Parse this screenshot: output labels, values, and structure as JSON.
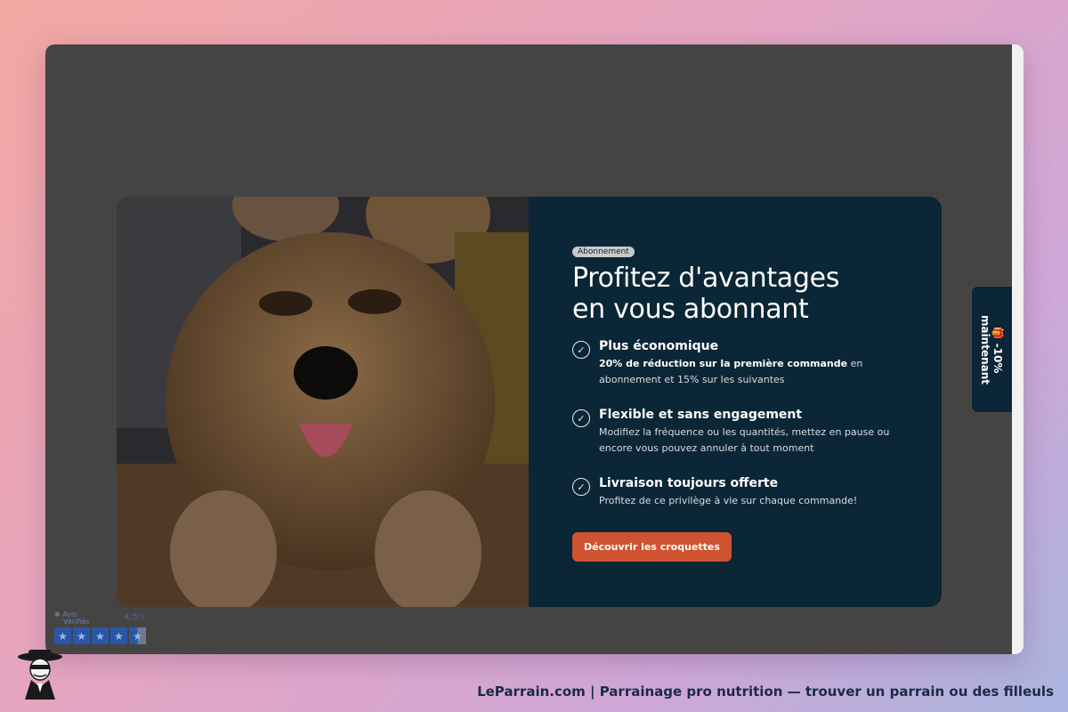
{
  "modal": {
    "badge": "Abonnement",
    "title_line1": "Profitez d'avantages",
    "title_line2": "en vous abonnant",
    "features": [
      {
        "title": "Plus économique",
        "desc_bold": "20% de réduction sur la première commande",
        "desc": " en abonnement et 15% sur les suivantes"
      },
      {
        "title": "Flexible et sans engagement",
        "desc": "Modifiez la fréquence ou les quantités, mettez en pause ou encore vous pouvez annuler à tout moment"
      },
      {
        "title": "Livraison toujours offerte",
        "desc": "Profitez de ce privilège à vie sur chaque commande!"
      }
    ],
    "cta_label": "Découvrir les croquettes",
    "image_alt": "dog-with-family-photo"
  },
  "side_tab": {
    "icon": "gift-icon",
    "line1": "-10%",
    "line2": "maintenant"
  },
  "reviews": {
    "brand_line1": "Avis",
    "brand_line2": "Vérifiés",
    "score": "4.5",
    "score_suffix": "/5",
    "stars": 4.5
  },
  "footer": {
    "caption": "LeParrain.com | Parrainage pro nutrition — trouver un parrain ou des filleuls"
  },
  "colors": {
    "card_bg": "#0b2636",
    "cta": "#d0532f",
    "star": "#2b56a8"
  }
}
